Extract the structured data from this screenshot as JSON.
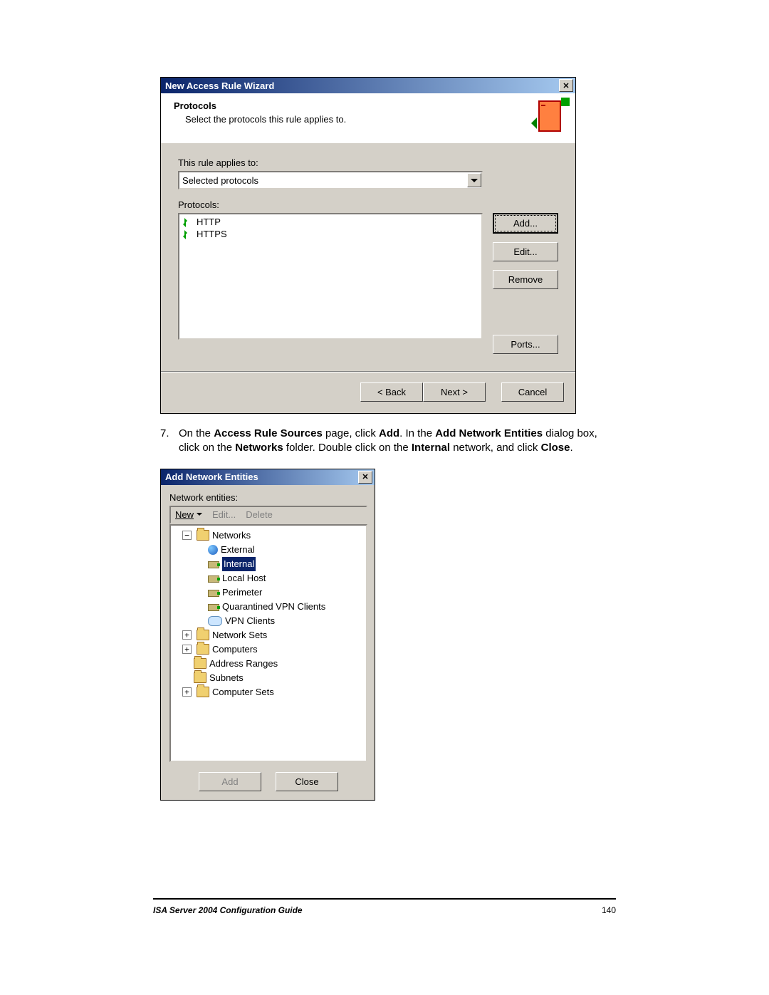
{
  "wizard": {
    "title": "New Access Rule Wizard",
    "bannerTitle": "Protocols",
    "bannerSub": "Select the protocols this rule applies to.",
    "appliesLabel": "This rule applies to:",
    "appliesValue": "Selected protocols",
    "protocolsLabel": "Protocols:",
    "items": [
      "HTTP",
      "HTTPS"
    ],
    "buttons": {
      "add": "Add...",
      "edit": "Edit...",
      "remove": "Remove",
      "ports": "Ports..."
    },
    "nav": {
      "back": "< Back",
      "next": "Next >",
      "cancel": "Cancel"
    }
  },
  "instruction": {
    "num": "7.",
    "segments": [
      "On the ",
      "Access Rule Sources",
      " page, click ",
      "Add",
      ". In the ",
      "Add Network Entities",
      " dialog box, click on the ",
      "Networks",
      " folder. Double click on the ",
      "Internal",
      " network, and click ",
      "Close",
      "."
    ]
  },
  "entities": {
    "title": "Add Network Entities",
    "label": "Network entities:",
    "toolbar": {
      "new": "New",
      "edit": "Edit...",
      "delete": "Delete"
    },
    "tree": {
      "networks": {
        "label": "Networks",
        "children": [
          "External",
          "Internal",
          "Local Host",
          "Perimeter",
          "Quarantined VPN Clients",
          "VPN Clients"
        ],
        "selected": "Internal"
      },
      "networkSets": "Network Sets",
      "computers": "Computers",
      "addressRanges": "Address Ranges",
      "subnets": "Subnets",
      "computerSets": "Computer Sets"
    },
    "buttons": {
      "add": "Add",
      "close": "Close"
    }
  },
  "footer": {
    "title": "ISA Server 2004 Configuration Guide",
    "page": "140"
  }
}
